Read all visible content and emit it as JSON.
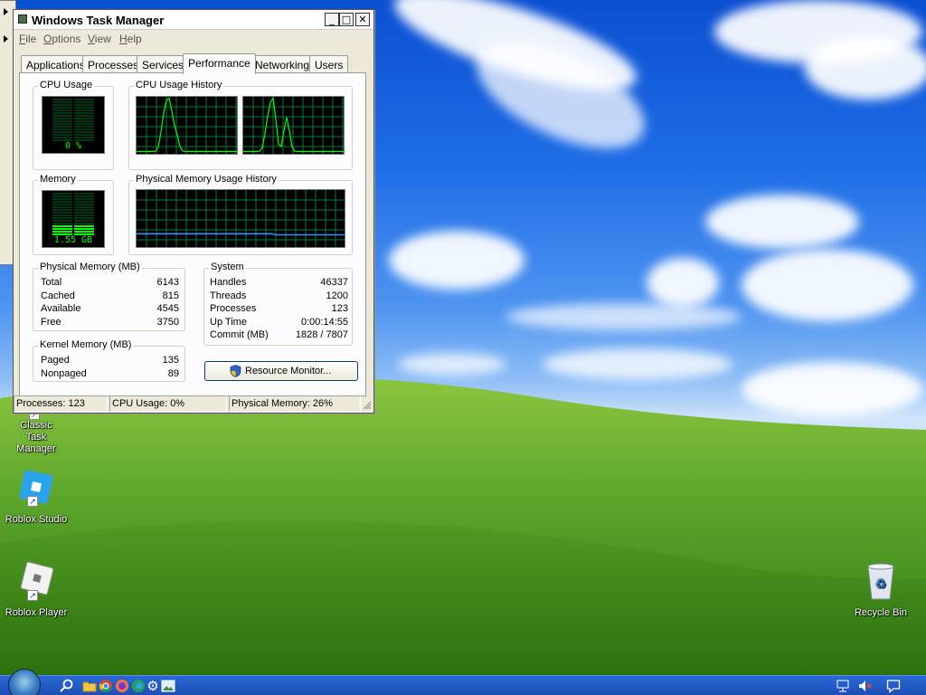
{
  "window": {
    "title": "Windows Task Manager",
    "controls": {
      "minimize": "_",
      "maximize": "□",
      "close": "✕"
    }
  },
  "menu": [
    {
      "label": "File",
      "accel": "F",
      "rest": "ile"
    },
    {
      "label": "Options",
      "accel": "O",
      "rest": "ptions"
    },
    {
      "label": "View",
      "accel": "V",
      "rest": "iew"
    },
    {
      "label": "Help",
      "accel": "H",
      "rest": "elp"
    }
  ],
  "tabs": [
    "Applications",
    "Processes",
    "Services",
    "Performance",
    "Networking",
    "Users"
  ],
  "active_tab": "Performance",
  "cpu": {
    "group_label": "CPU Usage",
    "value": "0 %",
    "percent": 0
  },
  "cpu_history": {
    "group_label": "CPU Usage History",
    "cores": 2
  },
  "memory": {
    "group_label": "Memory",
    "value": "1.55 GB",
    "fraction": 0.26
  },
  "memory_history": {
    "group_label": "Physical Memory Usage History",
    "fraction": 0.26
  },
  "physical_memory": {
    "group_label": "Physical Memory (MB)",
    "rows": [
      {
        "k": "Total",
        "v": "6143"
      },
      {
        "k": "Cached",
        "v": "815"
      },
      {
        "k": "Available",
        "v": "4545"
      },
      {
        "k": "Free",
        "v": "3750"
      }
    ]
  },
  "system": {
    "group_label": "System",
    "rows": [
      {
        "k": "Handles",
        "v": "46337"
      },
      {
        "k": "Threads",
        "v": "1200"
      },
      {
        "k": "Processes",
        "v": "123"
      },
      {
        "k": "Up Time",
        "v": "0:00:14:55"
      },
      {
        "k": "Commit (MB)",
        "v": "1828 / 7807"
      }
    ]
  },
  "kernel_memory": {
    "group_label": "Kernel Memory (MB)",
    "rows": [
      {
        "k": "Paged",
        "v": "135"
      },
      {
        "k": "Nonpaged",
        "v": "89"
      }
    ]
  },
  "resource_monitor_button": "Resource Monitor...",
  "status": {
    "processes": "Processes: 123",
    "cpu": "CPU Usage: 0%",
    "memory": "Physical Memory: 26%"
  },
  "desktop_icons": {
    "classic_tm": "Classic Task Manager",
    "roblox_studio": "Roblox Studio",
    "roblox_player": "Roblox Player",
    "recycle_bin": "Recycle Bin"
  },
  "taskbar_icons": [
    "search-icon",
    "folder-icon",
    "chrome-icon",
    "firefox-icon",
    "edge-icon",
    "gear-icon",
    "photos-icon"
  ],
  "tray_icons": [
    "network-icon",
    "volume-muted-icon",
    "notification-icon"
  ],
  "colors": {
    "graph_green": "#00ff00",
    "grid": "#008040",
    "memory_line": "#3a8dff",
    "taskbar": "#1d4fb3"
  }
}
